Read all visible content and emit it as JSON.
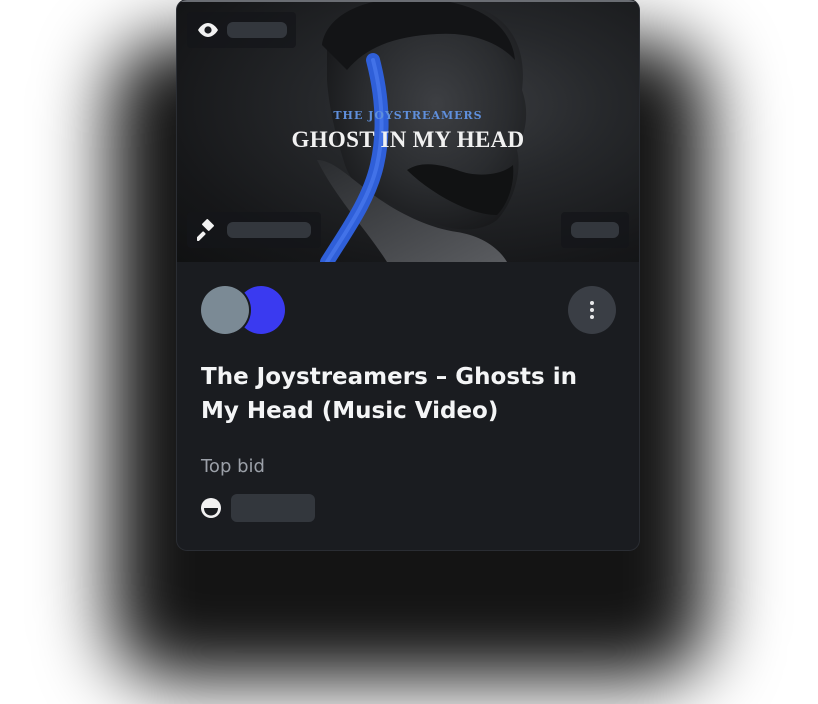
{
  "card": {
    "media": {
      "artist_label": "THE JOYSTREAMERS",
      "title_label": "GHOST IN MY HEAD",
      "views_icon": "eye-icon",
      "auction_icon": "gavel-icon"
    },
    "title": "The Joystreamers – Ghosts in My Head (Music Video)",
    "top_bid_label": "Top bid",
    "bidder_icon": "joystream-token-icon",
    "more_icon": "more-vertical-icon"
  },
  "colors": {
    "card_bg": "#1a1c20",
    "avatar_owner": "#7b8a95",
    "avatar_channel": "#4040f0",
    "skeleton": "#33373d",
    "accent_blue": "#5f8fdc"
  }
}
